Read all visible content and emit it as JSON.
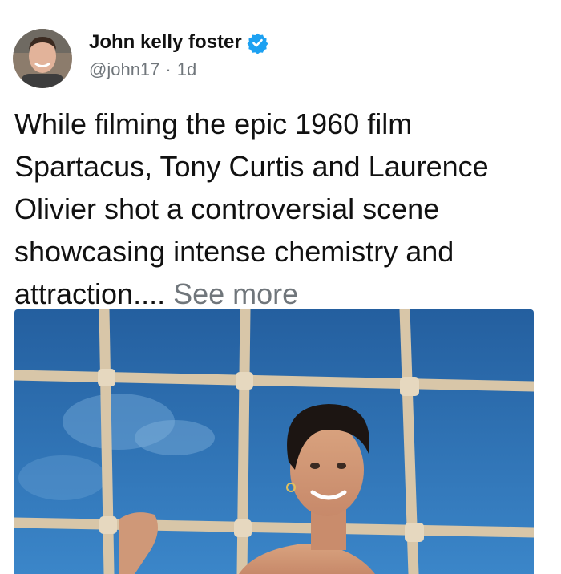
{
  "author": {
    "display_name": "John kelly foster",
    "handle": "@john17",
    "separator": "·",
    "timestamp": "1d",
    "verified_icon": "verified-badge-icon",
    "verified_color": "#1da1f2"
  },
  "post": {
    "text": "While filming the epic 1960 film Spartacus, Tony Curtis and Laurence Olivier shot a controversial scene showcasing intense chemistry and attraction....",
    "see_more_label": "See more"
  },
  "media": {
    "type": "photo",
    "sky_color": "#2b6fb3"
  }
}
